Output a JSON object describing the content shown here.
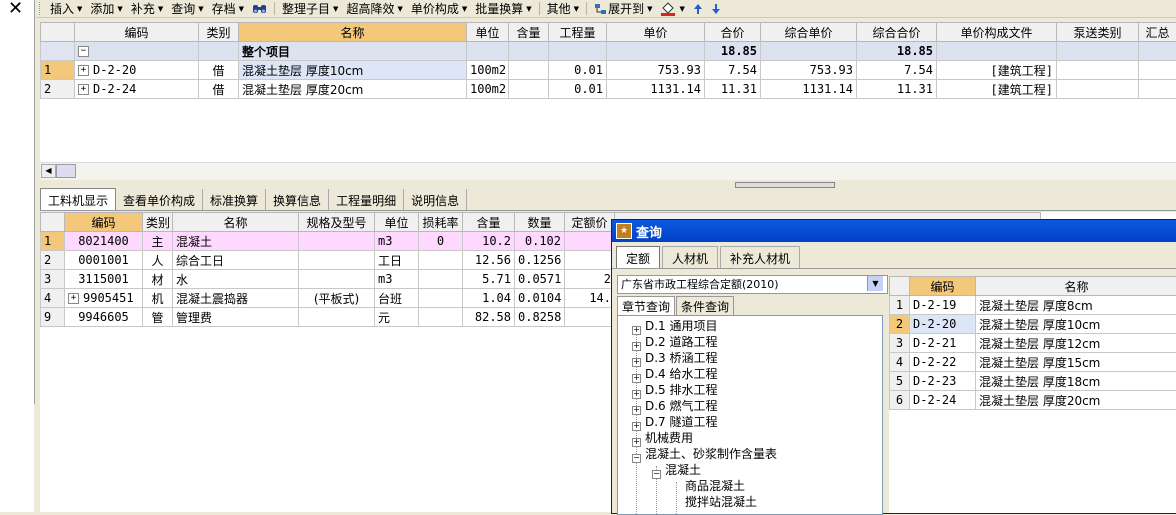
{
  "toolbar": {
    "close": "✕",
    "items": [
      {
        "label": "插入",
        "arrow": "▼"
      },
      {
        "label": "添加",
        "arrow": "▼"
      },
      {
        "label": "补充",
        "arrow": "▼"
      },
      {
        "label": "查询",
        "arrow": "▼"
      },
      {
        "label": "存档",
        "arrow": "▼"
      },
      {
        "label": "整理子目",
        "arrow": "▼"
      },
      {
        "label": "超高降效",
        "arrow": "▼"
      },
      {
        "label": "单价构成",
        "arrow": "▼"
      },
      {
        "label": "批量换算",
        "arrow": "▼"
      },
      {
        "label": "其他",
        "arrow": "▼"
      },
      {
        "label": "展开到",
        "arrow": "▼"
      }
    ]
  },
  "upper": {
    "columns": [
      "",
      "编码",
      "类别",
      "名称",
      "单位",
      "含量",
      "工程量",
      "单价",
      "合价",
      "综合单价",
      "综合合价",
      "单价构成文件",
      "泵送类别",
      "汇总"
    ],
    "summary": {
      "expander": "−",
      "name": "整个项目",
      "total": "18.85",
      "comp_total": "18.85"
    },
    "rows": [
      {
        "idx": "1",
        "code": "D-2-20",
        "type": "借",
        "name": "混凝土垫层 厚度10cm",
        "unit": "100m2",
        "content": "",
        "qty": "0.01",
        "price": "753.93",
        "total": "7.54",
        "comp_price": "753.93",
        "comp_total": "7.54",
        "file": "[建筑工程]",
        "pump": "",
        "sum": ""
      },
      {
        "idx": "2",
        "code": "D-2-24",
        "type": "借",
        "name": "混凝土垫层 厚度20cm",
        "unit": "100m2",
        "content": "",
        "qty": "0.01",
        "price": "1131.14",
        "total": "11.31",
        "comp_price": "1131.14",
        "comp_total": "11.31",
        "file": "[建筑工程]",
        "pump": "",
        "sum": ""
      }
    ]
  },
  "tabs": [
    "工料机显示",
    "查看单价构成",
    "标准换算",
    "换算信息",
    "工程量明细",
    "说明信息"
  ],
  "lower": {
    "columns": [
      "",
      "编码",
      "类别",
      "名称",
      "规格及型号",
      "单位",
      "损耗率",
      "含量",
      "数量",
      "定额价"
    ],
    "rows": [
      {
        "idx": "1",
        "code": "8021400",
        "type": "主",
        "name": "混凝土",
        "spec": "",
        "unit": "m3",
        "loss": "0",
        "content": "10.2",
        "amount": "0.102",
        "price": ""
      },
      {
        "idx": "2",
        "code": "0001001",
        "type": "人",
        "name": "综合工日",
        "spec": "",
        "unit": "工日",
        "loss": "",
        "content": "12.56",
        "amount": "0.1256",
        "price": ""
      },
      {
        "idx": "3",
        "code": "3115001",
        "type": "材",
        "name": "水",
        "spec": "",
        "unit": "m3",
        "loss": "",
        "content": "5.71",
        "amount": "0.0571",
        "price": "2"
      },
      {
        "idx": "4",
        "code": "9905451",
        "type": "机",
        "name": "混凝土震捣器",
        "spec": "(平板式)",
        "unit": "台班",
        "loss": "",
        "content": "1.04",
        "amount": "0.0104",
        "price": "14."
      },
      {
        "idx": "9",
        "code": "9946605",
        "type": "管",
        "name": "管理费",
        "spec": "",
        "unit": "元",
        "loss": "",
        "content": "82.58",
        "amount": "0.8258",
        "price": ""
      }
    ]
  },
  "dialog": {
    "title": "查询",
    "tabs": [
      "定额",
      "人材机",
      "补充人材机"
    ],
    "library": "广东省市政工程综合定额(2010)",
    "subtabs": [
      "章节查询",
      "条件查询"
    ],
    "tree": [
      {
        "label": "D.1 通用项目",
        "box": "+"
      },
      {
        "label": "D.2 道路工程",
        "box": "+"
      },
      {
        "label": "D.3 桥涵工程",
        "box": "+"
      },
      {
        "label": "D.4 给水工程",
        "box": "+"
      },
      {
        "label": "D.5 排水工程",
        "box": "+"
      },
      {
        "label": "D.6 燃气工程",
        "box": "+"
      },
      {
        "label": "D.7 隧道工程",
        "box": "+"
      },
      {
        "label": "机械费用",
        "box": "+"
      },
      {
        "label": "混凝土、砂浆制作含量表",
        "box": "−"
      },
      {
        "label": "混凝土",
        "box": "−"
      },
      {
        "label": "商品混凝土",
        "box": ""
      },
      {
        "label": "搅拌站混凝土",
        "box": ""
      }
    ],
    "grid": {
      "columns": [
        "",
        "编码",
        "名称"
      ],
      "rows": [
        {
          "idx": "1",
          "code": "D-2-19",
          "name": "混凝土垫层 厚度8cm"
        },
        {
          "idx": "2",
          "code": "D-2-20",
          "name": "混凝土垫层 厚度10cm"
        },
        {
          "idx": "3",
          "code": "D-2-21",
          "name": "混凝土垫层 厚度12cm"
        },
        {
          "idx": "4",
          "code": "D-2-22",
          "name": "混凝土垫层 厚度15cm"
        },
        {
          "idx": "5",
          "code": "D-2-23",
          "name": "混凝土垫层 厚度18cm"
        },
        {
          "idx": "6",
          "code": "D-2-24",
          "name": "混凝土垫层 厚度20cm"
        }
      ]
    }
  },
  "colors": {
    "header_active": "#f4c87a",
    "selected_row": "#ffd8ff",
    "title_bar": "#0a5adf"
  }
}
